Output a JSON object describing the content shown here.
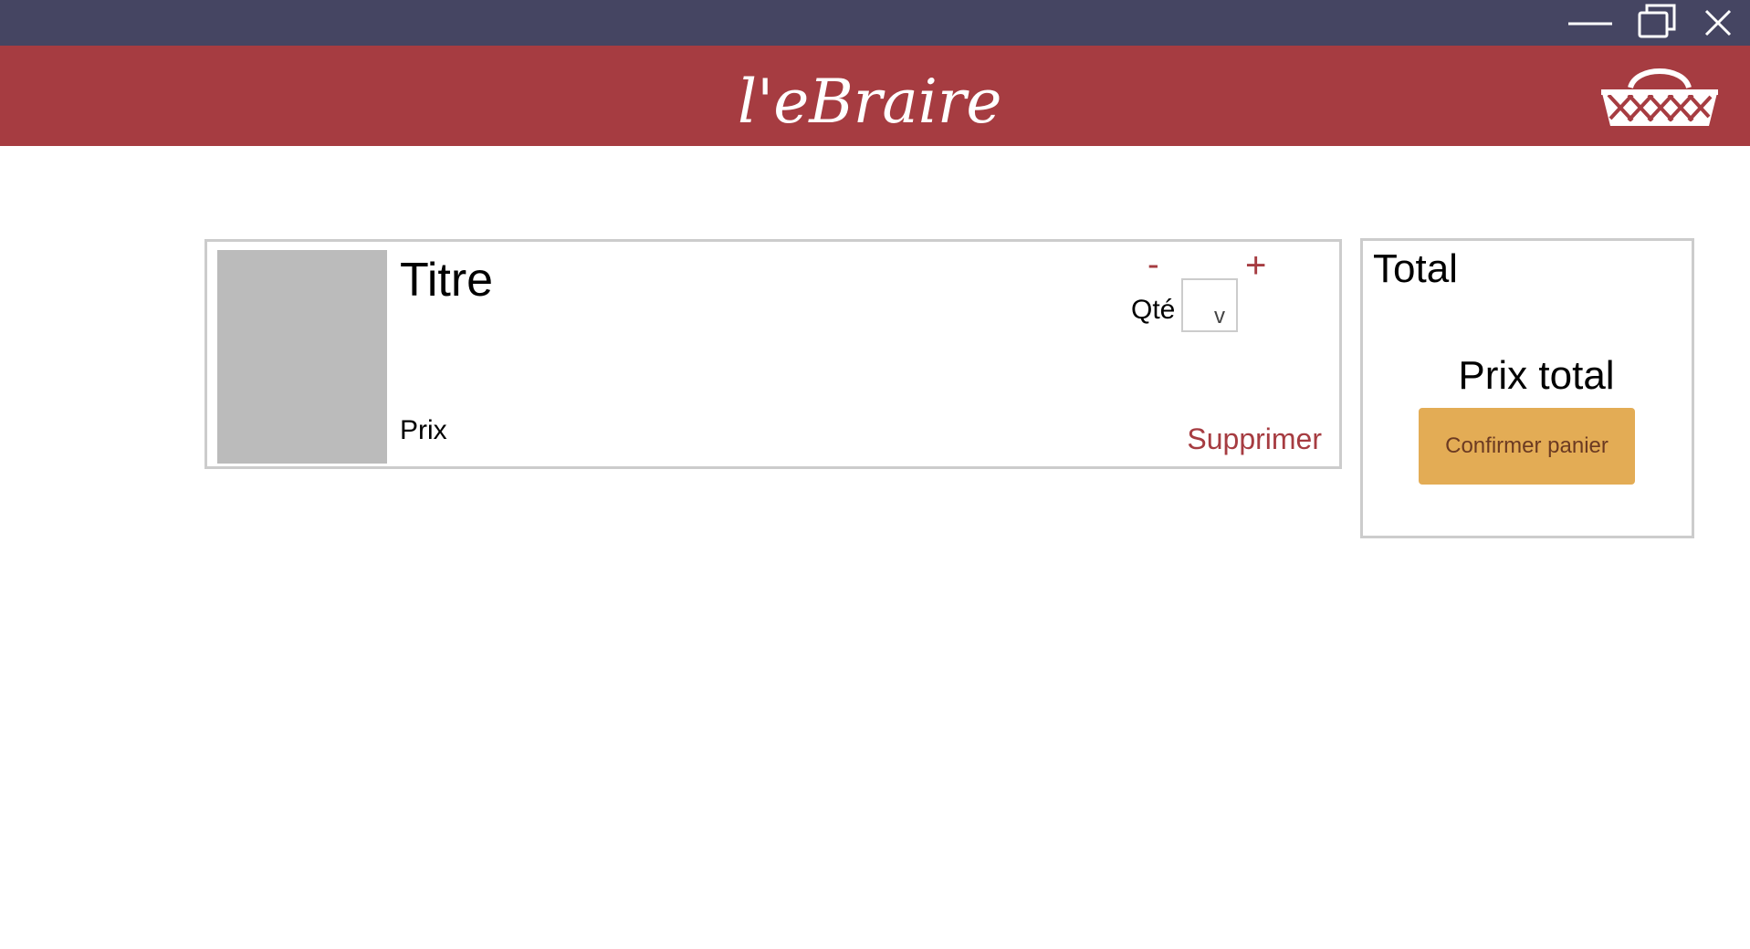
{
  "window": {
    "controls": [
      "minimize-icon",
      "restore-icon",
      "close-icon"
    ],
    "titlebar_color": "#454562"
  },
  "header": {
    "logo_text": "l'eBraire",
    "color": "#a63c41",
    "cart_icon": "basket-icon"
  },
  "cart_item": {
    "title": "Titre",
    "price": "Prix",
    "qty_label": "Qté",
    "minus": "-",
    "plus": "+",
    "qty_select_arrow": "v",
    "delete": "Supprimer"
  },
  "total": {
    "title": "Total",
    "total_price": "Prix total",
    "confirm_label": "Confirmer panier",
    "confirm_color": "#e3ac55"
  }
}
